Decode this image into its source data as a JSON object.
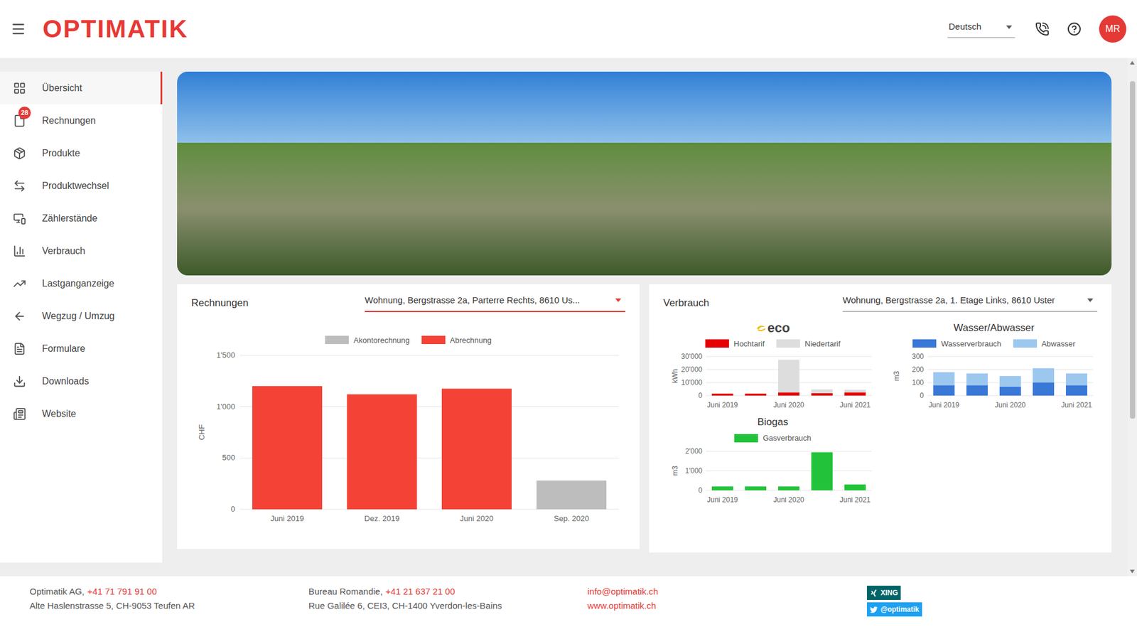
{
  "header": {
    "logo": "OPTIMATIK",
    "language": "Deutsch",
    "avatar": "MR"
  },
  "sidebar": {
    "items": [
      {
        "label": "Übersicht",
        "selected": true
      },
      {
        "label": "Rechnungen",
        "selected": false,
        "badge": "28"
      },
      {
        "label": "Produkte",
        "selected": false
      },
      {
        "label": "Produktwechsel",
        "selected": false
      },
      {
        "label": "Zählerstände",
        "selected": false
      },
      {
        "label": "Verbrauch",
        "selected": false
      },
      {
        "label": "Lastganganzeige",
        "selected": false
      },
      {
        "label": "Wegzug / Umzug",
        "selected": false
      },
      {
        "label": "Formulare",
        "selected": false
      },
      {
        "label": "Downloads",
        "selected": false
      },
      {
        "label": "Website",
        "selected": false
      }
    ]
  },
  "rechnungen": {
    "title": "Rechnungen",
    "property": "Wohnung, Bergstrasse 2a, Parterre Rechts, 8610 Us...",
    "chart": {
      "y_label": "CHF",
      "y_max": 1500,
      "y_ticks": [
        "0",
        "500",
        "1'000",
        "1'500"
      ],
      "x_labels": [
        "Juni 2019",
        "Dez. 2019",
        "Juni 2020",
        "Sep. 2020"
      ],
      "series": [
        {
          "name": "Akontorechnung",
          "color": "#bdbdbd",
          "values": [
            0,
            0,
            0,
            280
          ]
        },
        {
          "name": "Abrechnung",
          "color": "#f44336",
          "values": [
            1200,
            1120,
            1175,
            0
          ]
        }
      ]
    }
  },
  "verbrauch": {
    "title": "Verbrauch",
    "property": "Wohnung, Bergstrasse 2a, 1. Etage Links, 8610 Uster",
    "charts": [
      {
        "title": "eco",
        "kind": "logo",
        "y_label": "kWh",
        "y_max": 30000,
        "y_ticks": [
          "0",
          "10'000",
          "20'000",
          "30'000"
        ],
        "x_labels": [
          "Juni 2019",
          "",
          "Juni 2020",
          "",
          "Juni 2021"
        ],
        "series": [
          {
            "name": "Hochtarif",
            "color": "#e60000",
            "values": [
              1500,
              1500,
              2500,
              1800,
              2500
            ]
          },
          {
            "name": "Niedertarif",
            "color": "#dddddd",
            "values": [
              0,
              0,
              25000,
              3000,
              2000
            ]
          }
        ]
      },
      {
        "title": "Wasser/Abwasser",
        "kind": "text",
        "y_label": "m3",
        "y_max": 300,
        "y_ticks": [
          "0",
          "100",
          "200",
          "300"
        ],
        "x_labels": [
          "Juni 2019",
          "",
          "Juni 2020",
          "",
          "Juni 2021"
        ],
        "series": [
          {
            "name": "Wasserverbrauch",
            "color": "#3a78d8",
            "values": [
              80,
              80,
              70,
              100,
              80
            ]
          },
          {
            "name": "Abwasser",
            "color": "#9cc8f0",
            "values": [
              100,
              90,
              80,
              110,
              90
            ]
          }
        ]
      },
      {
        "title": "Biogas",
        "kind": "text",
        "y_label": "m3",
        "y_max": 2000,
        "y_ticks": [
          "0",
          "1'000",
          "2'000"
        ],
        "x_labels": [
          "Juni 2019",
          "",
          "Juni 2020",
          "",
          "Juni 2021"
        ],
        "series": [
          {
            "name": "Gasverbrauch",
            "color": "#22c33a",
            "values": [
              200,
              200,
              200,
              1950,
              300
            ]
          }
        ]
      }
    ]
  },
  "footer": {
    "columns": [
      {
        "name": "Optimatik AG,",
        "phone": "+41 71 791 91 00",
        "address": "Alte Haslenstrasse 5, CH-9053 Teufen AR"
      },
      {
        "name": "Bureau Romandie,",
        "phone": "+41 21 637 21 00",
        "address": "Rue Galilée 6, CEI3, CH-1400 Yverdon-les-Bains"
      }
    ],
    "email": "info@optimatik.ch",
    "website": "www.optimatik.ch",
    "social": [
      {
        "label": "XING",
        "color": "#026466"
      },
      {
        "label": "@optimatik",
        "color": "#1da1f2"
      }
    ]
  }
}
